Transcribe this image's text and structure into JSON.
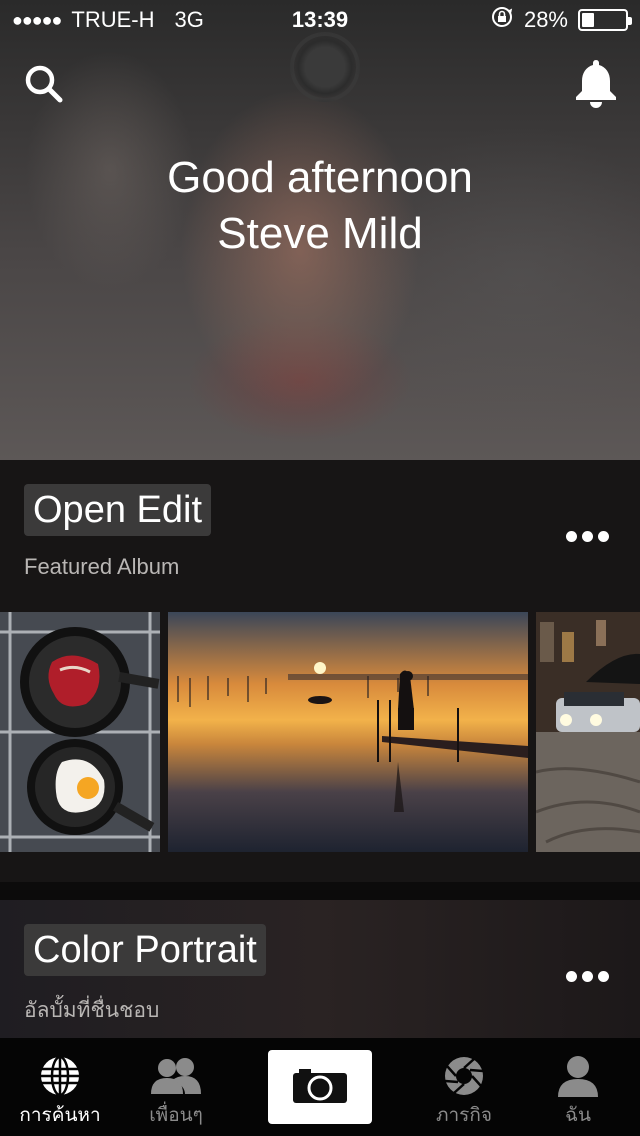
{
  "status": {
    "signal": "●●●●●",
    "carrier": "TRUE-H",
    "network": "3G",
    "time": "13:39",
    "battery_percent": "28%",
    "battery_level": 0.28
  },
  "header": {
    "greeting_line1": "Good afternoon",
    "greeting_line2": "Steve Mild",
    "search_icon": "search-icon",
    "bell_icon": "bell-icon"
  },
  "albums": [
    {
      "title": "Open Edit",
      "subtitle": "Featured Album"
    },
    {
      "title": "Color Portrait",
      "subtitle": "อัลบั้มที่ชื่นชอบ"
    }
  ],
  "photos": [
    {
      "name": "cooking-steak-egg"
    },
    {
      "name": "sunset-pier"
    },
    {
      "name": "night-street-car"
    }
  ],
  "tabs": [
    {
      "label": "การค้นหา",
      "icon": "globe-icon"
    },
    {
      "label": "เพื่อนๆ",
      "icon": "friends-icon"
    },
    {
      "label": "",
      "icon": "camera-icon"
    },
    {
      "label": "ภารกิจ",
      "icon": "aperture-icon"
    },
    {
      "label": "ฉัน",
      "icon": "person-icon"
    }
  ],
  "colors": {
    "background": "#000000",
    "section": "#171515",
    "title_chip": "#3b3a3a",
    "inactive_tab": "#8b8b8b"
  }
}
